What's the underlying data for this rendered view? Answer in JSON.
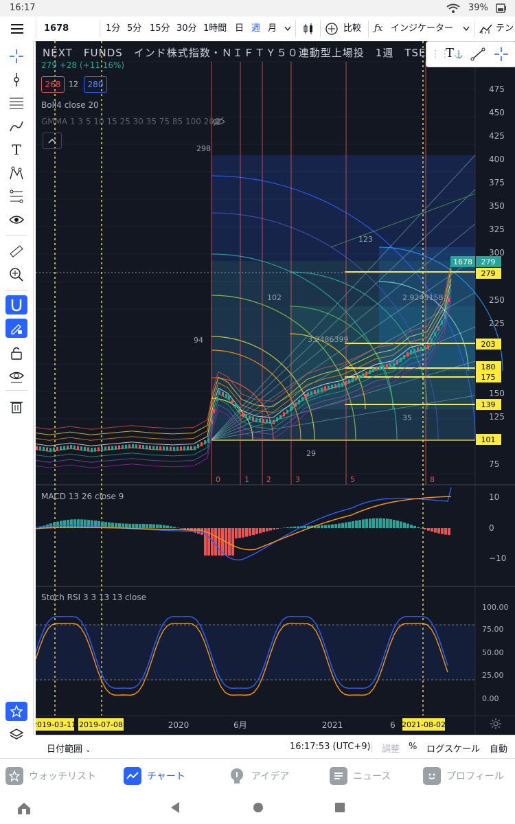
{
  "status": {
    "time": "16:17",
    "battery": "39%"
  },
  "toolbar": {
    "symbol": "1678",
    "intervals": [
      "1分",
      "5分",
      "15分",
      "30分",
      "1時間",
      "日",
      "週",
      "月"
    ],
    "active_interval": "週",
    "compare": "比較",
    "indicators": "インジケーター",
    "more": "テン"
  },
  "chart": {
    "title": "NEXT　FUNDS　インド株式指数・ＮＩＦＴＹ５０連動型上場投　1週　TSE",
    "price_line": "279  +28 (+11.16%)",
    "bid": "268",
    "spread": "12",
    "ask": "280",
    "indicator_boll": "Boll4 close 20",
    "indicator_gmma": "GMMA 1 3 5 10 15 25 30 35 75 85 100 200",
    "overlay_labels": [
      {
        "t": "298",
        "c": "#9aa0a6"
      },
      {
        "t": "123",
        "c": "#9aa0a6"
      },
      {
        "t": "102",
        "c": "#9aa0a6"
      },
      {
        "t": "2.9245158",
        "c": "#9aa0a6"
      },
      {
        "t": "3.2486399",
        "c": "#9aa0a6"
      },
      {
        "t": "94",
        "c": "#9aa0a6"
      },
      {
        "t": "35",
        "c": "#9aa0a6"
      },
      {
        "t": "29",
        "c": "#9aa0a6"
      }
    ],
    "fib_time_labels": [
      "0",
      "1",
      "2",
      "3",
      "5",
      "8"
    ],
    "price_axis": [
      "475",
      "450",
      "425",
      "400",
      "375",
      "350",
      "325",
      "300",
      "250",
      "225",
      "150",
      "125",
      "75"
    ],
    "price_tags": [
      {
        "t": "1678",
        "bg": "#26a69a",
        "fg": "#ffffff"
      },
      {
        "t": "279",
        "bg": "#26a69a",
        "fg": "#ffffff"
      },
      {
        "t": "279",
        "bg": "#ffeb3b",
        "fg": "#000000"
      },
      {
        "t": "203",
        "bg": "#ffeb3b",
        "fg": "#000000"
      },
      {
        "t": "180",
        "bg": "#ffeb3b",
        "fg": "#000000"
      },
      {
        "t": "175",
        "bg": "#ffeb3b",
        "fg": "#000000"
      },
      {
        "t": "139",
        "bg": "#ffeb3b",
        "fg": "#000000"
      },
      {
        "t": "101",
        "bg": "#ffeb3b",
        "fg": "#000000"
      }
    ],
    "macd_label": "MACD 13 26 close 9",
    "macd_axis": [
      "10",
      "0",
      "−10"
    ],
    "stoch_label": "Stoch RSI 3 3 13 13 close",
    "stoch_axis": [
      "100.00",
      "75.00",
      "50.00",
      "25.00",
      "0.00"
    ],
    "time_axis": [
      "2020",
      "6月",
      "2021",
      "6"
    ],
    "time_tags": [
      "2019-03-11",
      "2019-07-08",
      "2021-08-02"
    ]
  },
  "bottombar": {
    "range": "日付範囲",
    "clock": "16:17:53 (UTC+9)",
    "adjust": "調整",
    "percent": "%",
    "log": "ログスケール",
    "auto": "自動"
  },
  "tabs": [
    {
      "label": "ウォッチリスト",
      "icon": "star-icon",
      "active": false
    },
    {
      "label": "チャート",
      "icon": "chart-icon",
      "active": true
    },
    {
      "label": "アイデア",
      "icon": "lightbulb-icon",
      "active": false
    },
    {
      "label": "ニュース",
      "icon": "news-icon",
      "active": false
    },
    {
      "label": "プロフィール",
      "icon": "profile-icon",
      "active": false
    }
  ]
}
